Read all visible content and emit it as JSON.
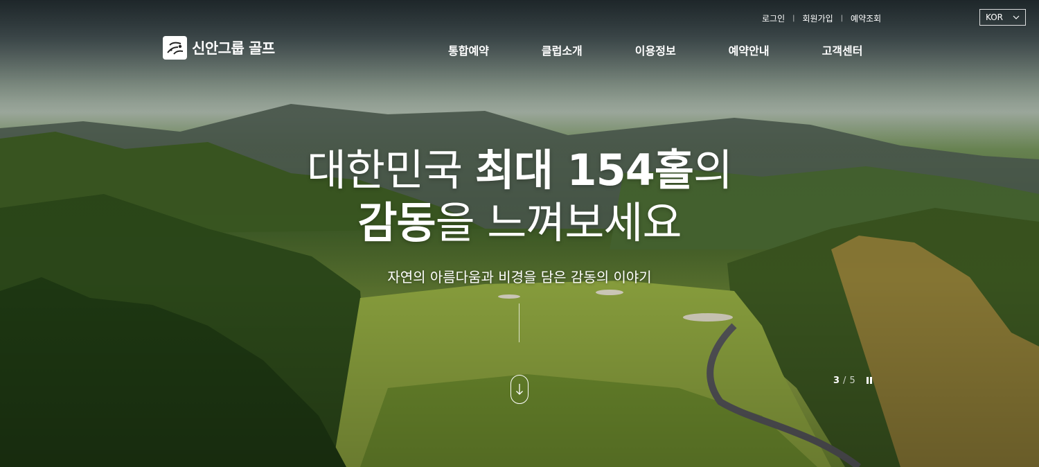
{
  "header": {
    "logo_text": "신안그룹 골프",
    "util": [
      "로그인",
      "회원가입",
      "예약조회"
    ],
    "language": "KOR",
    "nav": [
      "통합예약",
      "클럽소개",
      "이용정보",
      "예약안내",
      "고객센터"
    ]
  },
  "hero": {
    "line1_part1": "대한민국 ",
    "line1_bold": "최대 154홀",
    "line1_part2": "의",
    "line2_bold": "감동",
    "line2_part": "을 느껴보세요",
    "subtitle": "자연의 아름다움과 비경을 담은 감동의 이야기"
  },
  "slider": {
    "current": "3",
    "separator": "/",
    "total": "5"
  },
  "icons": [
    "logo-mark-icon",
    "chevron-down-icon",
    "arrow-down-icon",
    "pause-icon"
  ]
}
